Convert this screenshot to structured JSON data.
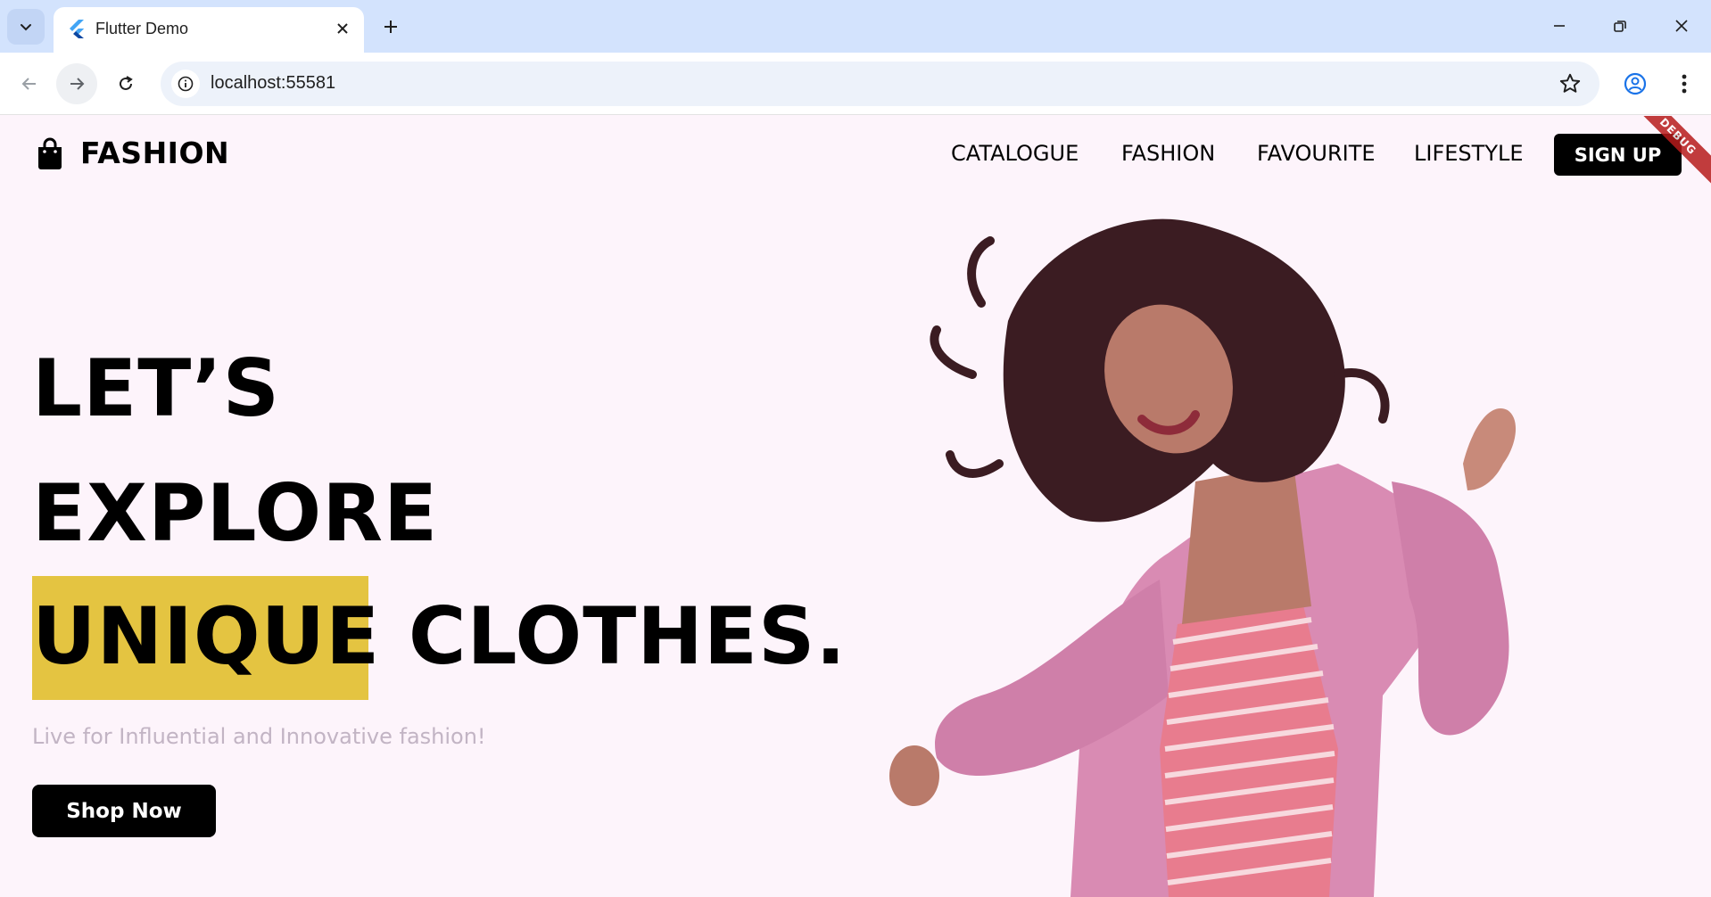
{
  "browser": {
    "tab": {
      "title": "Flutter Demo",
      "favicon": "flutter-logo-icon"
    },
    "address": {
      "url": "localhost:55581"
    },
    "colors": {
      "tabstrip": "#d3e3fd",
      "omnibox": "#edf2fa"
    }
  },
  "app": {
    "brand": {
      "name": "FASHION",
      "icon": "shopping-bag-icon"
    },
    "nav": {
      "items": [
        {
          "label": "CATALOGUE"
        },
        {
          "label": "FASHION"
        },
        {
          "label": "FAVOURITE"
        },
        {
          "label": "LIFESTYLE"
        }
      ],
      "signup_label": "SIGN UP"
    },
    "debug_banner": "DEBUG",
    "hero": {
      "line1": "LET’S",
      "line2": "EXPLORE",
      "line3_highlight": "UNIQUE",
      "line3_rest": "CLOTHES.",
      "tagline": "Live for Influential and Innovative fashion!",
      "cta_label": "Shop Now"
    },
    "colors": {
      "background": "#fdf4fb",
      "highlight": "#e4c441",
      "button": "#000000",
      "tagline": "#c2b4c4"
    }
  }
}
